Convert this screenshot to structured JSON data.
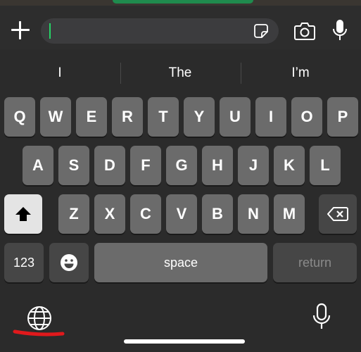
{
  "input_bar": {
    "plus_icon": "plus-icon",
    "field_value": "",
    "sticker_icon": "sticker-icon",
    "camera_icon": "camera-icon",
    "mic_icon": "microphone-icon",
    "caret_color": "#25d366"
  },
  "suggestions": [
    "I",
    "The",
    "I’m"
  ],
  "keyboard": {
    "row1": [
      "Q",
      "W",
      "E",
      "R",
      "T",
      "Y",
      "U",
      "I",
      "O",
      "P"
    ],
    "row2": [
      "A",
      "S",
      "D",
      "F",
      "G",
      "H",
      "J",
      "K",
      "L"
    ],
    "row3": [
      "Z",
      "X",
      "C",
      "V",
      "B",
      "N",
      "M"
    ],
    "shift_icon": "shift-icon",
    "delete_icon": "delete-icon",
    "numbers_label": "123",
    "emoji_icon": "emoji-icon",
    "space_label": "space",
    "return_label": "return",
    "globe_icon": "globe-icon",
    "dictation_icon": "microphone-icon",
    "annotation_color": "#e0191c"
  }
}
